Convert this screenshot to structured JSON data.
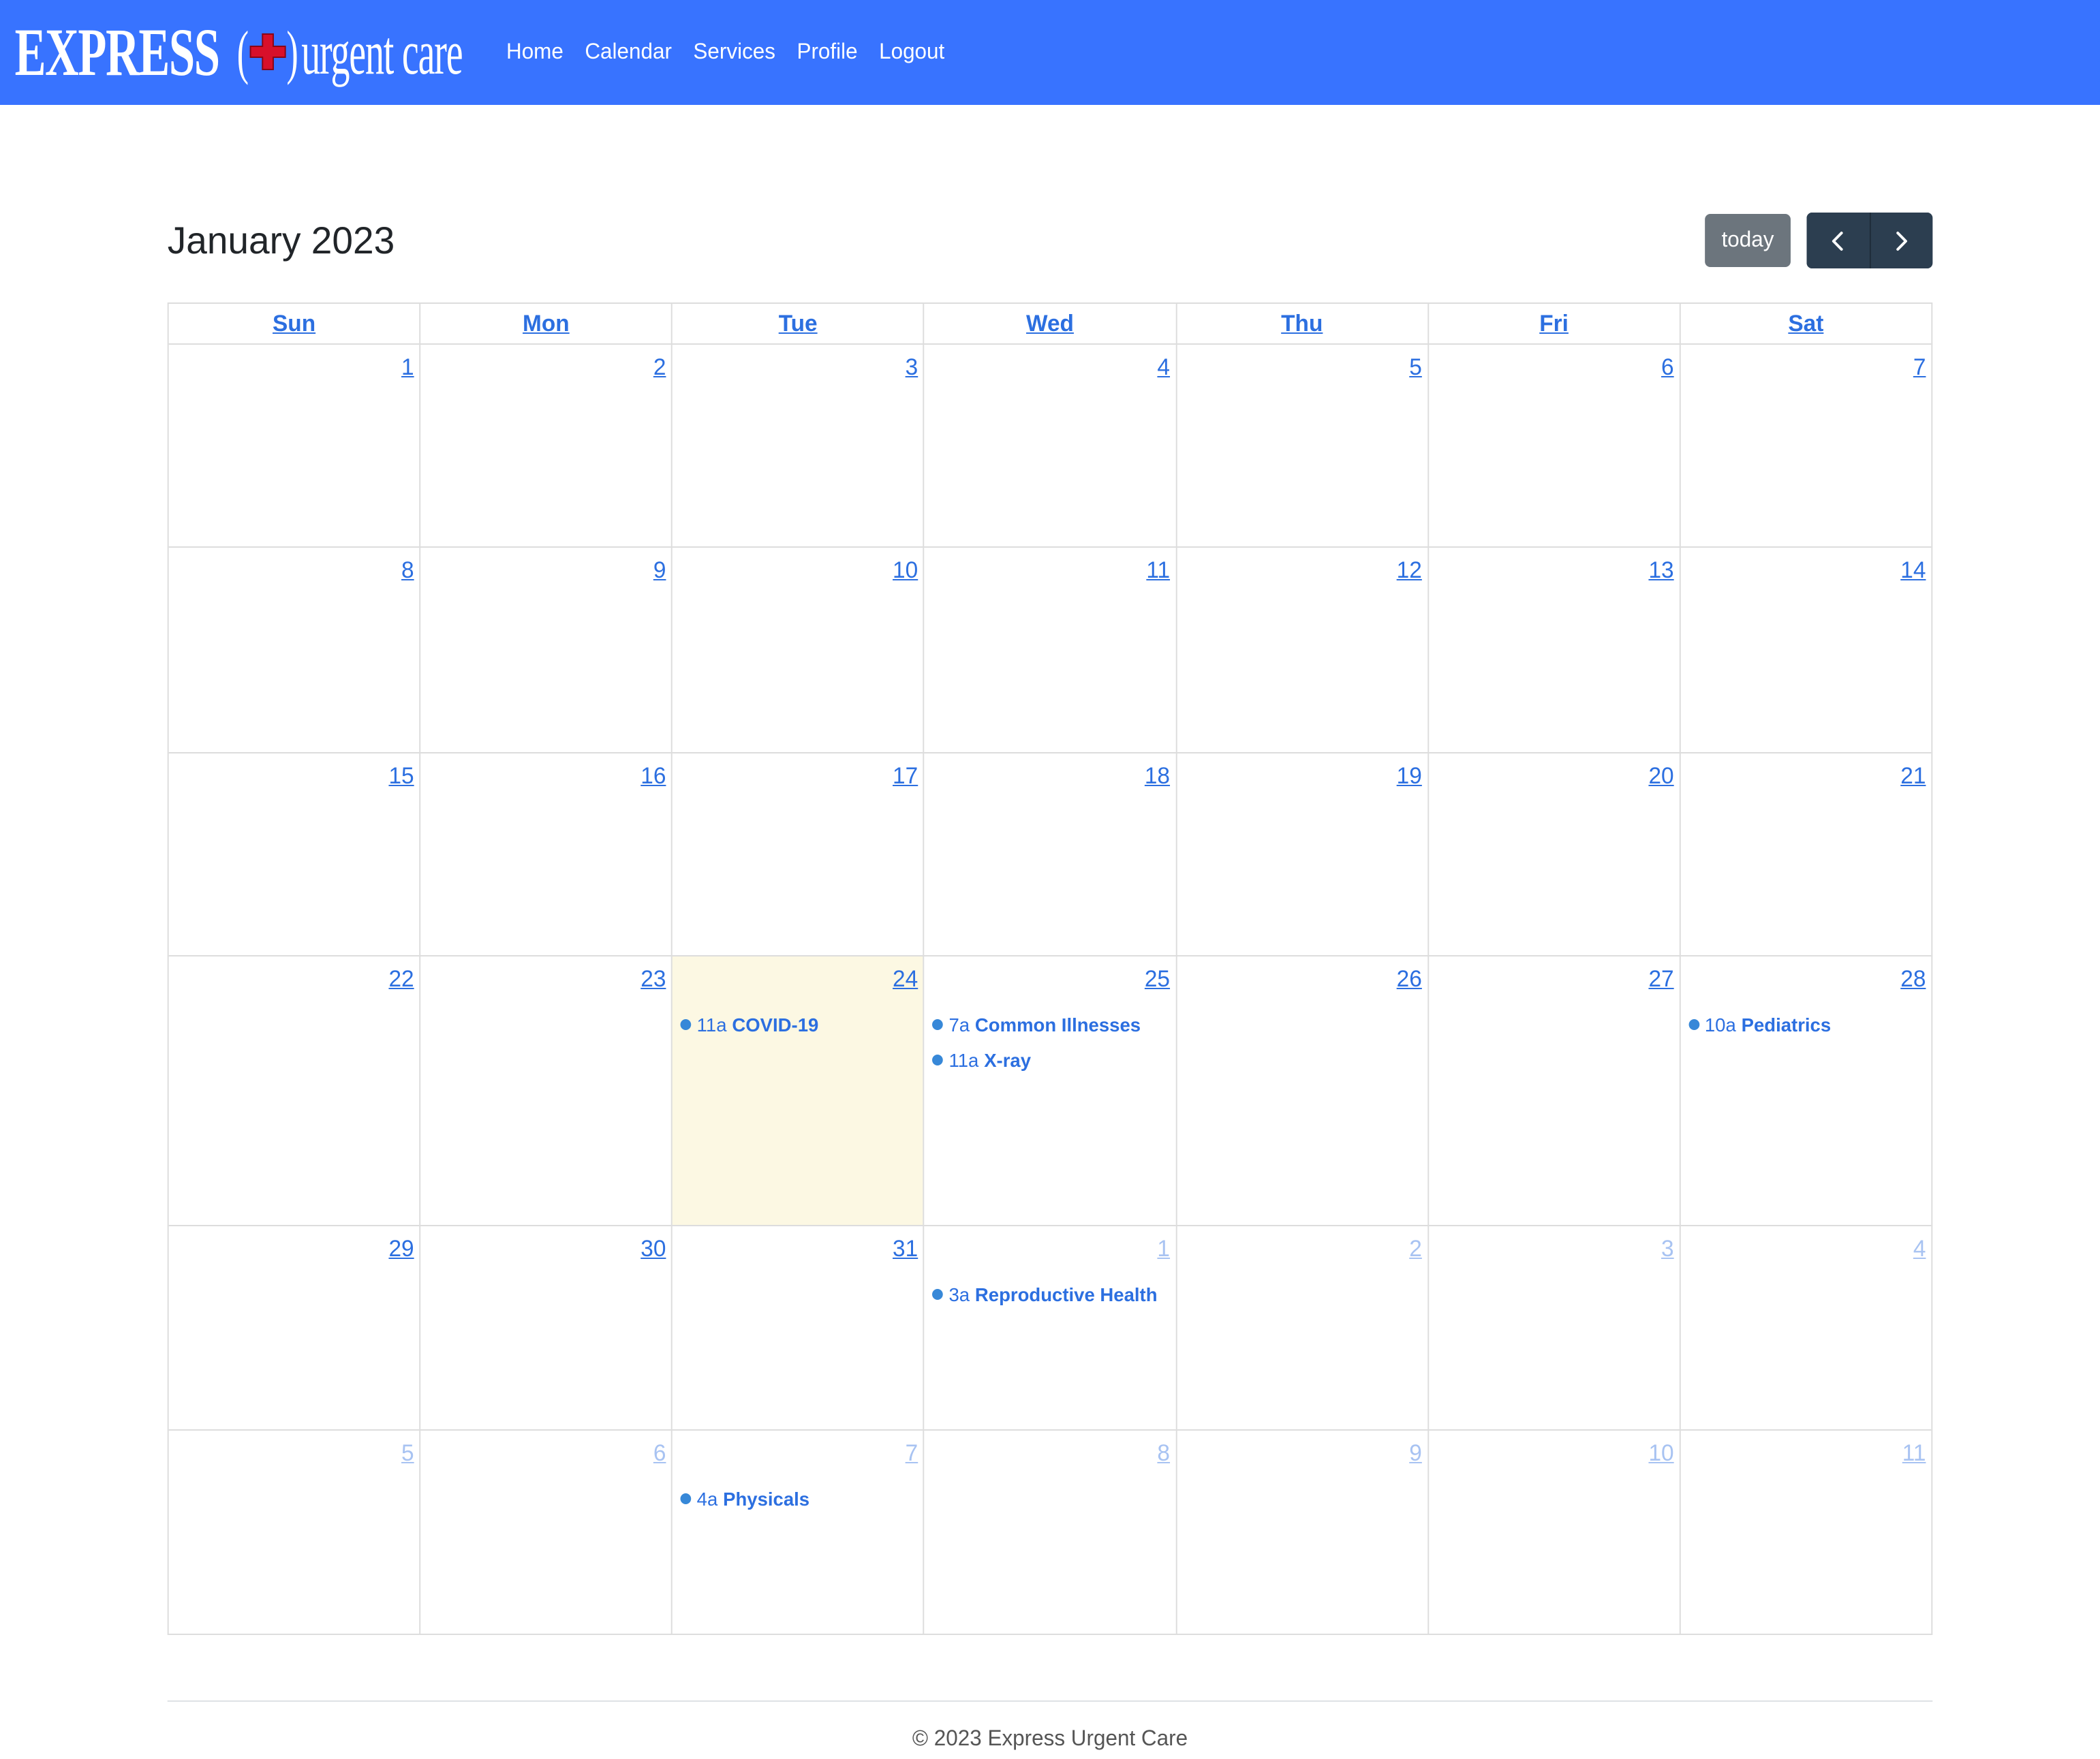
{
  "brand": {
    "express": "EXPRESS",
    "urgent_care": "urgent care",
    "paren_open": "(",
    "paren_close": ")",
    "cross_icon": "red-cross-icon"
  },
  "nav": {
    "items": [
      {
        "label": "Home"
      },
      {
        "label": "Calendar"
      },
      {
        "label": "Services"
      },
      {
        "label": "Profile"
      },
      {
        "label": "Logout"
      }
    ]
  },
  "toolbar": {
    "title": "January 2023",
    "today_label": "today",
    "prev_icon": "chevron-left-icon",
    "next_icon": "chevron-right-icon"
  },
  "calendar": {
    "day_headers": [
      "Sun",
      "Mon",
      "Tue",
      "Wed",
      "Thu",
      "Fri",
      "Sat"
    ],
    "weeks": [
      [
        {
          "num": "1"
        },
        {
          "num": "2"
        },
        {
          "num": "3"
        },
        {
          "num": "4"
        },
        {
          "num": "5"
        },
        {
          "num": "6"
        },
        {
          "num": "7"
        }
      ],
      [
        {
          "num": "8"
        },
        {
          "num": "9"
        },
        {
          "num": "10"
        },
        {
          "num": "11"
        },
        {
          "num": "12"
        },
        {
          "num": "13"
        },
        {
          "num": "14"
        }
      ],
      [
        {
          "num": "15"
        },
        {
          "num": "16"
        },
        {
          "num": "17"
        },
        {
          "num": "18"
        },
        {
          "num": "19"
        },
        {
          "num": "20"
        },
        {
          "num": "21"
        }
      ],
      [
        {
          "num": "22"
        },
        {
          "num": "23"
        },
        {
          "num": "24",
          "today": true,
          "events": [
            {
              "time": "11a",
              "title": "COVID-19"
            }
          ]
        },
        {
          "num": "25",
          "events": [
            {
              "time": "7a",
              "title": "Common Illnesses"
            },
            {
              "time": "11a",
              "title": "X-ray"
            }
          ]
        },
        {
          "num": "26"
        },
        {
          "num": "27"
        },
        {
          "num": "28",
          "events": [
            {
              "time": "10a",
              "title": "Pediatrics"
            }
          ]
        }
      ],
      [
        {
          "num": "29"
        },
        {
          "num": "30"
        },
        {
          "num": "31"
        },
        {
          "num": "1",
          "other": true,
          "events": [
            {
              "time": "3a",
              "title": "Reproductive Health"
            }
          ]
        },
        {
          "num": "2",
          "other": true
        },
        {
          "num": "3",
          "other": true
        },
        {
          "num": "4",
          "other": true
        }
      ],
      [
        {
          "num": "5",
          "other": true
        },
        {
          "num": "6",
          "other": true
        },
        {
          "num": "7",
          "other": true,
          "events": [
            {
              "time": "4a",
              "title": "Physicals"
            }
          ]
        },
        {
          "num": "8",
          "other": true
        },
        {
          "num": "9",
          "other": true
        },
        {
          "num": "10",
          "other": true
        },
        {
          "num": "11",
          "other": true
        }
      ]
    ]
  },
  "footer": {
    "text": "© 2023 Express Urgent Care"
  },
  "colors": {
    "navbar": "#3873ff",
    "link": "#2c6fe0",
    "today_bg": "#fcf8e3",
    "event_dot": "#3788d8",
    "today_button": "#6c757d",
    "nav_buttons": "#2c3e50"
  }
}
